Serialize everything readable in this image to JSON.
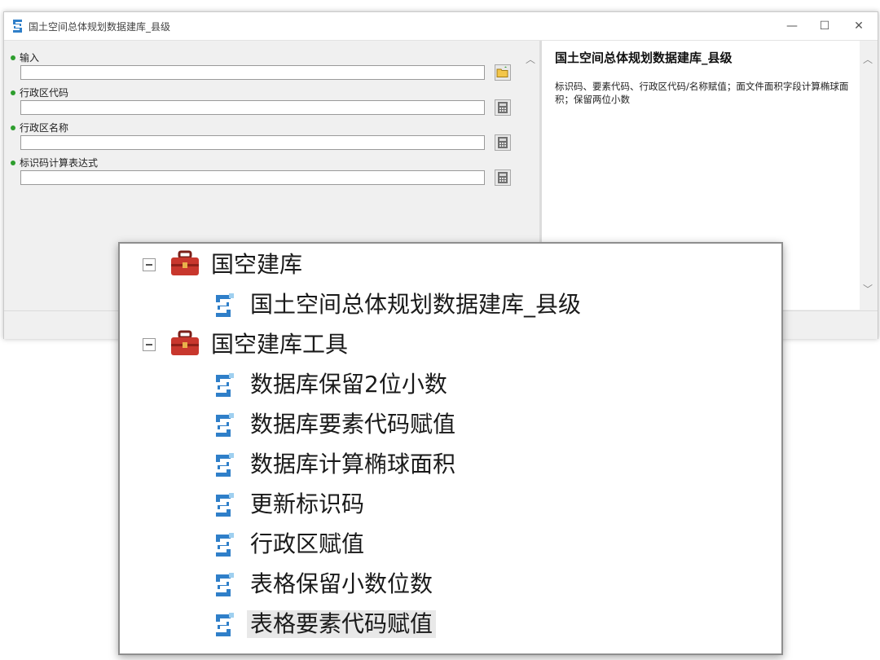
{
  "window": {
    "title": "国土空间总体规划数据建库_县级",
    "controls": {
      "minimize": "—",
      "maximize": "☐",
      "close": "✕"
    }
  },
  "parameters": [
    {
      "label": "输入",
      "value": "",
      "button": "folder-icon"
    },
    {
      "label": "行政区代码",
      "value": "",
      "button": "calculator-icon"
    },
    {
      "label": "行政区名称",
      "value": "",
      "button": "calculator-icon"
    },
    {
      "label": "标识码计算表达式",
      "value": "",
      "button": "calculator-icon"
    }
  ],
  "help": {
    "title": "国土空间总体规划数据建库_县级",
    "body": "标识码、要素代码、行政区代码/名称赋值；面文件面积字段计算椭球面积；保留两位小数"
  },
  "tree": {
    "toolbox1": {
      "label": "国空建库",
      "tools": [
        "国土空间总体规划数据建库_县级"
      ]
    },
    "toolbox2": {
      "label": "国空建库工具",
      "tools": [
        "数据库保留2位小数",
        "数据库要素代码赋值",
        "数据库计算椭球面积",
        "更新标识码",
        "行政区赋值",
        "表格保留小数位数",
        "表格要素代码赋值"
      ]
    }
  },
  "colors": {
    "required_dot": "#2e9e2e",
    "toolbox_red": "#c8372d",
    "script_blue": "#2f7fc9"
  }
}
